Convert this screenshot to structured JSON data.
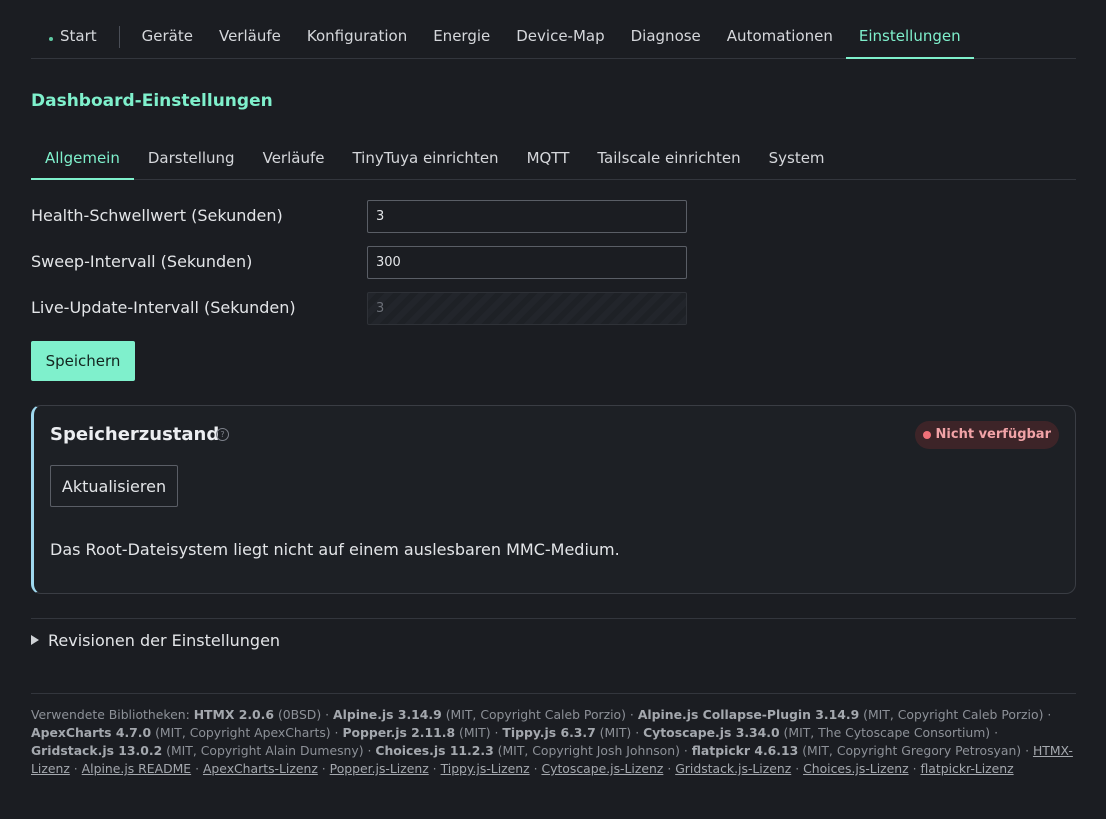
{
  "nav": {
    "start": "Start",
    "items": [
      "Geräte",
      "Verläufe",
      "Konfiguration",
      "Energie",
      "Device-Map",
      "Diagnose",
      "Automationen",
      "Einstellungen"
    ],
    "active": "Einstellungen"
  },
  "section_title": "Dashboard-Einstellungen",
  "subtabs": [
    "Allgemein",
    "Darstellung",
    "Verläufe",
    "TinyTuya einrichten",
    "MQTT",
    "Tailscale einrichten",
    "System"
  ],
  "active_subtab": "Allgemein",
  "form": {
    "health_label": "Health-Schwellwert (Sekunden)",
    "health_value": "3",
    "sweep_label": "Sweep-Intervall (Sekunden)",
    "sweep_value": "300",
    "live_label": "Live-Update-Intervall (Sekunden)",
    "live_value": "3",
    "save_label": "Speichern"
  },
  "storage": {
    "title": "Speicherzustand",
    "help_glyph": "?",
    "badge": "Nicht verfügbar",
    "refresh_label": "Aktualisieren",
    "message": "Das Root-Dateisystem liegt nicht auf einem auslesbaren MMC-Medium."
  },
  "revisions_label": "Revisionen der Einstellungen",
  "footer": {
    "intro": "Verwendete Bibliotheken:",
    "libs": [
      {
        "name": "HTMX 2.0.6",
        "license": "(0BSD)"
      },
      {
        "name": "Alpine.js 3.14.9",
        "license": "(MIT, Copyright Caleb Porzio)"
      },
      {
        "name": "Alpine.js Collapse-Plugin 3.14.9",
        "license": "(MIT, Copyright Caleb Porzio)"
      },
      {
        "name": "ApexCharts 4.7.0",
        "license": "(MIT, Copyright ApexCharts)"
      },
      {
        "name": "Popper.js 2.11.8",
        "license": "(MIT)"
      },
      {
        "name": "Tippy.js 6.3.7",
        "license": "(MIT)"
      },
      {
        "name": "Cytoscape.js 3.34.0",
        "license": "(MIT, The Cytoscape Consortium)"
      },
      {
        "name": "Gridstack.js 13.0.2",
        "license": "(MIT, Copyright Alain Dumesny)"
      },
      {
        "name": "Choices.js 11.2.3",
        "license": "(MIT, Copyright Josh Johnson)"
      },
      {
        "name": "flatpickr 4.6.13",
        "license": "(MIT, Copyright Gregory Petrosyan)"
      }
    ],
    "links": [
      "HTMX-Lizenz",
      "Alpine.js README",
      "ApexCharts-Lizenz",
      "Popper.js-Lizenz",
      "Tippy.js-Lizenz",
      "Cytoscape.js-Lizenz",
      "Gridstack.js-Lizenz",
      "Choices.js-Lizenz",
      "flatpickr-Lizenz"
    ],
    "separator": " · "
  },
  "colors": {
    "accent": "#7ff0cc",
    "background": "#1b1d22",
    "error": "#f07078"
  }
}
